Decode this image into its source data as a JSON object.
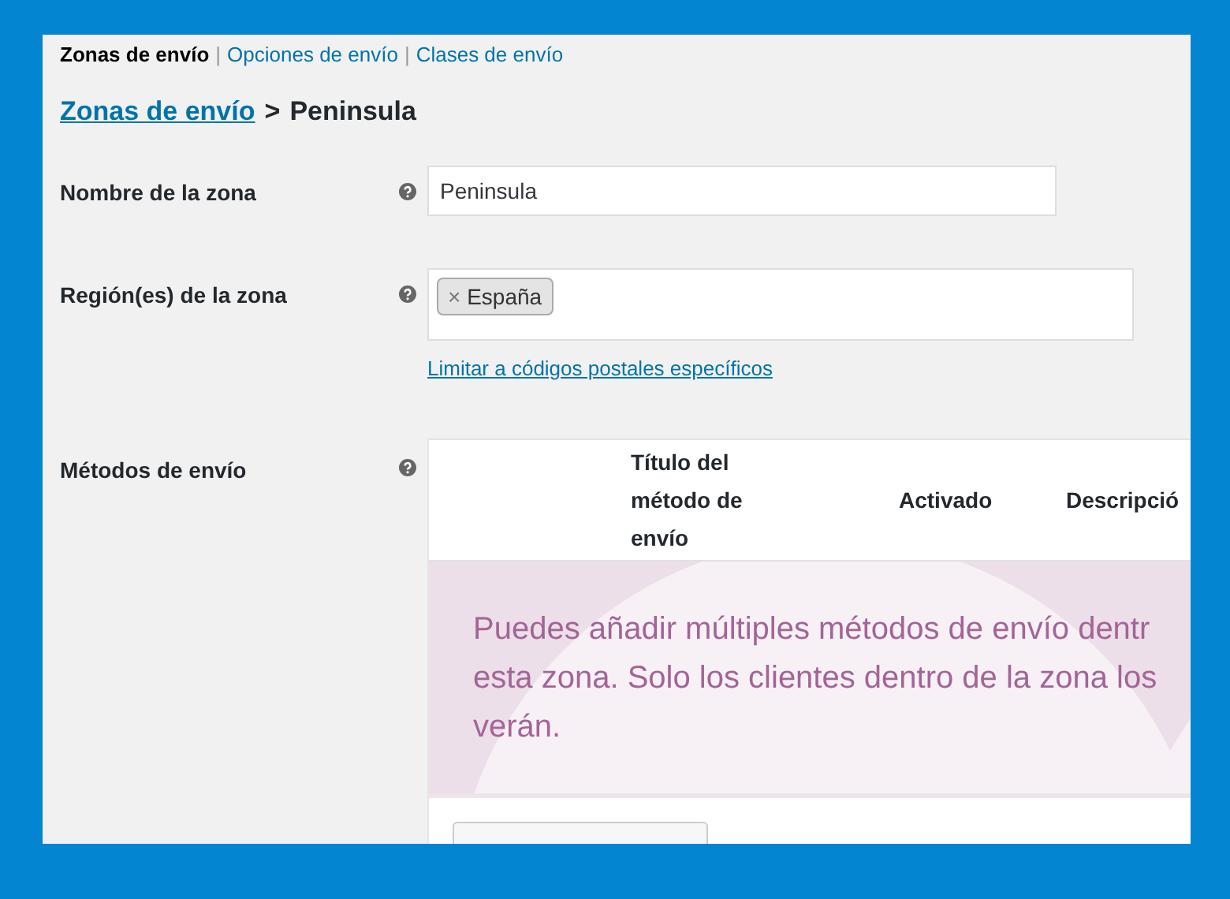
{
  "subnav_separator": "|",
  "subnav": [
    {
      "label": "Zonas de envío",
      "selected": true
    },
    {
      "label": "Opciones de envío",
      "selected": false
    },
    {
      "label": "Clases de envío",
      "selected": false
    }
  ],
  "breadcrumb": {
    "link": "Zonas de envío",
    "separator": ">",
    "current": "Peninsula"
  },
  "zone_name": {
    "label": "Nombre de la zona",
    "value": "Peninsula"
  },
  "zone_regions": {
    "label": "Región(es) de la zona",
    "tags": [
      "España"
    ],
    "tag_remove": "×",
    "postcode_link": "Limitar a códigos postales específicos"
  },
  "shipping_methods": {
    "label": "Métodos de envío",
    "columns": [
      "",
      "Título del método de envío",
      "Activado",
      "Descripció"
    ],
    "empty_lines": [
      "Puedes añadir múltiples métodos de envío dentr",
      "esta zona. Solo los clientes dentro de la zona los",
      "verán."
    ]
  }
}
